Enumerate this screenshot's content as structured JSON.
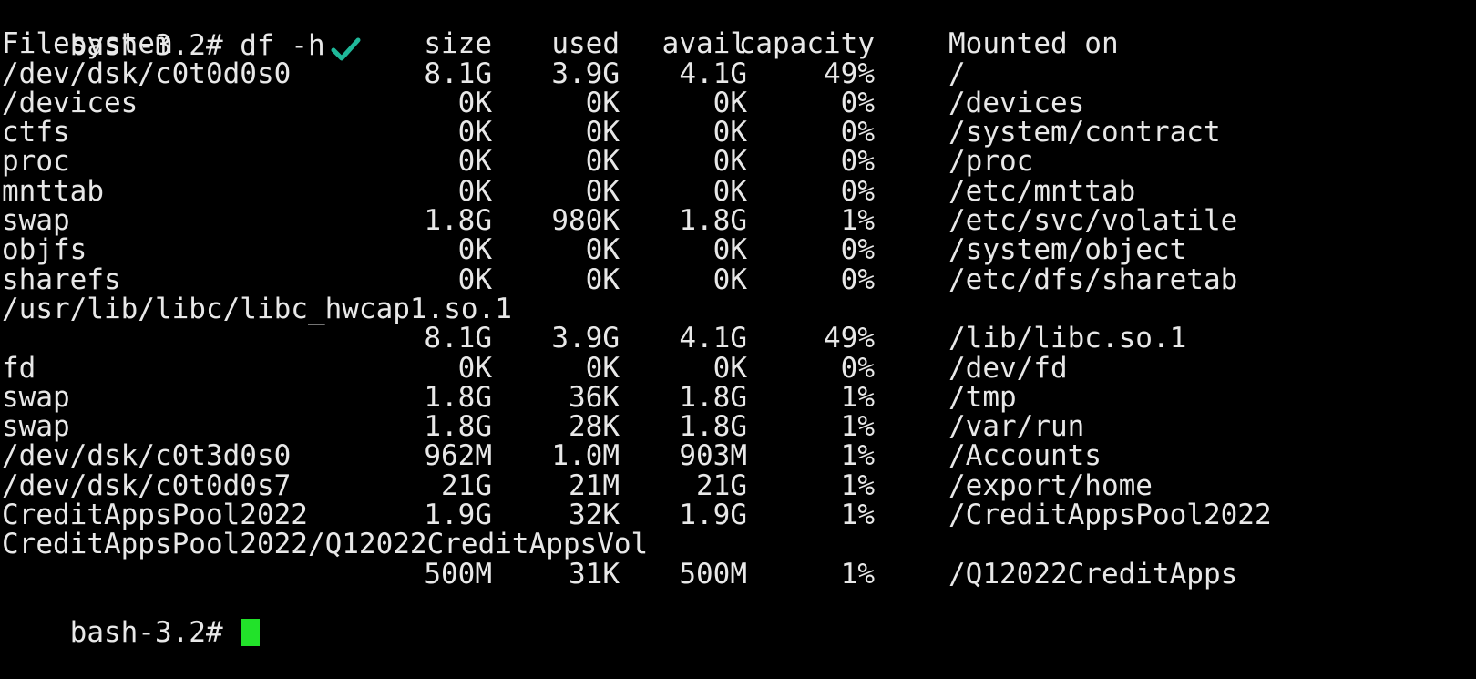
{
  "terminal": {
    "prompt": "bash-3.2# ",
    "command": "df -h",
    "check_color": "#1fb89a",
    "cursor_color": "#22e22a",
    "header": {
      "filesystem": "Filesystem",
      "size": "size",
      "used": "used",
      "avail": "avail",
      "capacity": "capacity",
      "mounted_on": "Mounted on"
    },
    "rows": [
      {
        "filesystem": "/dev/dsk/c0t0d0s0",
        "size": "8.1G",
        "used": "3.9G",
        "avail": "4.1G",
        "capacity": "49%",
        "mounted_on": "/"
      },
      {
        "filesystem": "/devices",
        "size": "0K",
        "used": "0K",
        "avail": "0K",
        "capacity": "0%",
        "mounted_on": "/devices"
      },
      {
        "filesystem": "ctfs",
        "size": "0K",
        "used": "0K",
        "avail": "0K",
        "capacity": "0%",
        "mounted_on": "/system/contract"
      },
      {
        "filesystem": "proc",
        "size": "0K",
        "used": "0K",
        "avail": "0K",
        "capacity": "0%",
        "mounted_on": "/proc"
      },
      {
        "filesystem": "mnttab",
        "size": "0K",
        "used": "0K",
        "avail": "0K",
        "capacity": "0%",
        "mounted_on": "/etc/mnttab"
      },
      {
        "filesystem": "swap",
        "size": "1.8G",
        "used": "980K",
        "avail": "1.8G",
        "capacity": "1%",
        "mounted_on": "/etc/svc/volatile"
      },
      {
        "filesystem": "objfs",
        "size": "0K",
        "used": "0K",
        "avail": "0K",
        "capacity": "0%",
        "mounted_on": "/system/object"
      },
      {
        "filesystem": "sharefs",
        "size": "0K",
        "used": "0K",
        "avail": "0K",
        "capacity": "0%",
        "mounted_on": "/etc/dfs/sharetab"
      },
      {
        "filesystem": "/usr/lib/libc/libc_hwcap1.so.1",
        "size": "",
        "used": "",
        "avail": "",
        "capacity": "",
        "mounted_on": ""
      },
      {
        "filesystem": "",
        "size": "8.1G",
        "used": "3.9G",
        "avail": "4.1G",
        "capacity": "49%",
        "mounted_on": "/lib/libc.so.1"
      },
      {
        "filesystem": "fd",
        "size": "0K",
        "used": "0K",
        "avail": "0K",
        "capacity": "0%",
        "mounted_on": "/dev/fd"
      },
      {
        "filesystem": "swap",
        "size": "1.8G",
        "used": "36K",
        "avail": "1.8G",
        "capacity": "1%",
        "mounted_on": "/tmp"
      },
      {
        "filesystem": "swap",
        "size": "1.8G",
        "used": "28K",
        "avail": "1.8G",
        "capacity": "1%",
        "mounted_on": "/var/run"
      },
      {
        "filesystem": "/dev/dsk/c0t3d0s0",
        "size": "962M",
        "used": "1.0M",
        "avail": "903M",
        "capacity": "1%",
        "mounted_on": "/Accounts"
      },
      {
        "filesystem": "/dev/dsk/c0t0d0s7",
        "size": "21G",
        "used": "21M",
        "avail": "21G",
        "capacity": "1%",
        "mounted_on": "/export/home"
      },
      {
        "filesystem": "CreditAppsPool2022",
        "size": "1.9G",
        "used": "32K",
        "avail": "1.9G",
        "capacity": "1%",
        "mounted_on": "/CreditAppsPool2022"
      },
      {
        "filesystem": "CreditAppsPool2022/Q12022CreditAppsVol",
        "size": "",
        "used": "",
        "avail": "",
        "capacity": "",
        "mounted_on": ""
      },
      {
        "filesystem": "",
        "size": "500M",
        "used": "31K",
        "avail": "500M",
        "capacity": "1%",
        "mounted_on": "/Q12022CreditApps"
      }
    ],
    "final_prompt": "bash-3.2# "
  }
}
